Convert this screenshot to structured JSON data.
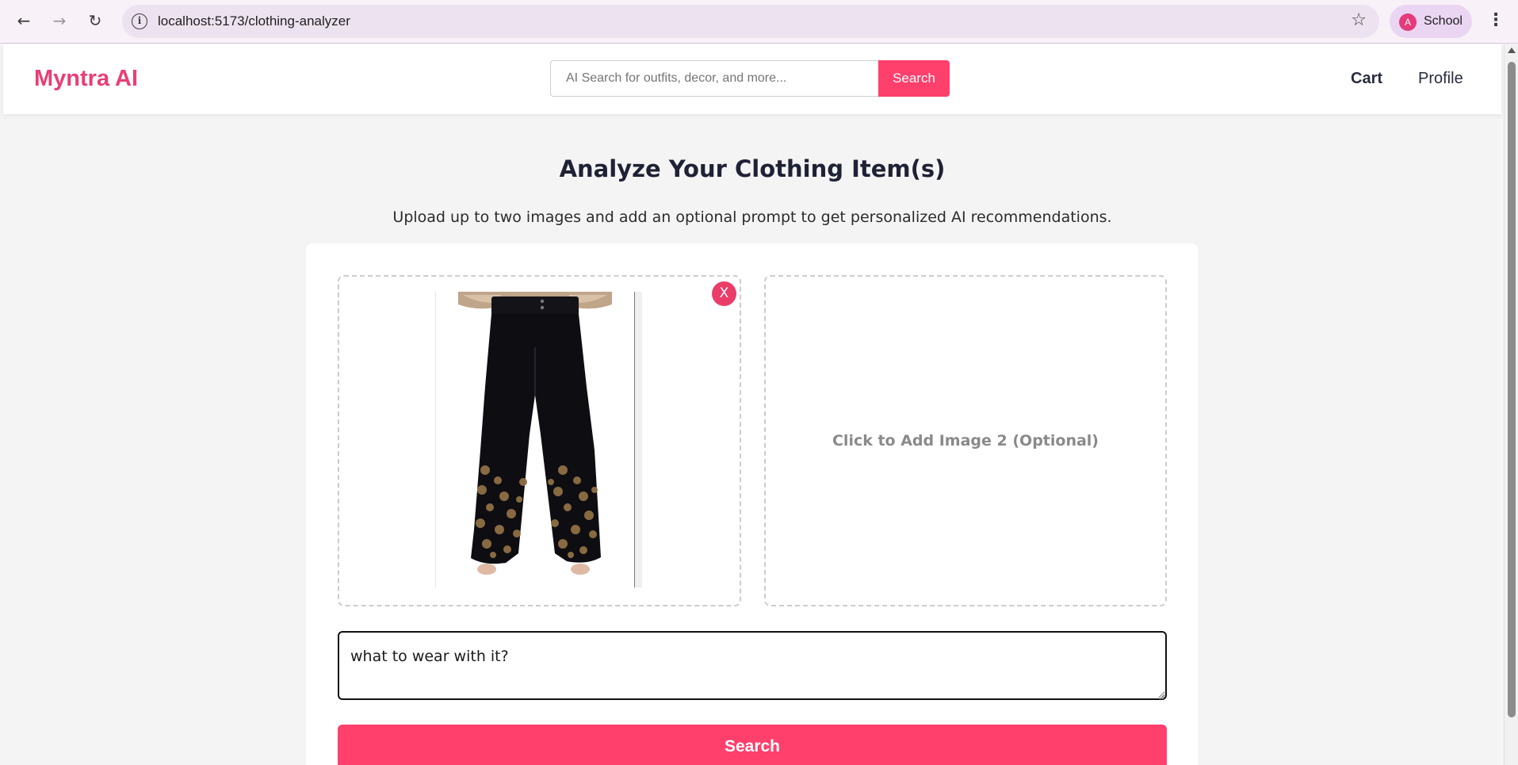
{
  "browser": {
    "url": "localhost:5173/clothing-analyzer",
    "profile_initial": "A",
    "profile_name": "School",
    "icons": [
      "back-icon",
      "forward-icon",
      "reload-icon",
      "site-info-icon",
      "bookmark-star-icon",
      "menu-kebab-icon"
    ]
  },
  "header": {
    "logo": "Myntra AI",
    "search_placeholder": "AI Search for outfits, decor, and more...",
    "search_button": "Search",
    "nav": {
      "cart": "Cart",
      "profile": "Profile"
    }
  },
  "main": {
    "title": "Analyze Your Clothing Item(s)",
    "subtitle": "Upload up to two images and add an optional prompt to get personalized AI recommendations.",
    "image1": {
      "remove_label": "X",
      "alt": "black palazzo pants with gold floral print"
    },
    "image2": {
      "placeholder": "Click to Add Image 2 (Optional)"
    },
    "prompt_value": "what to wear with it?",
    "submit_label": "Search"
  },
  "colors": {
    "brand": "#ff3f6c",
    "logo": "#e93e75",
    "title_text": "#1f2235",
    "page_bg": "#f4f4f4"
  }
}
